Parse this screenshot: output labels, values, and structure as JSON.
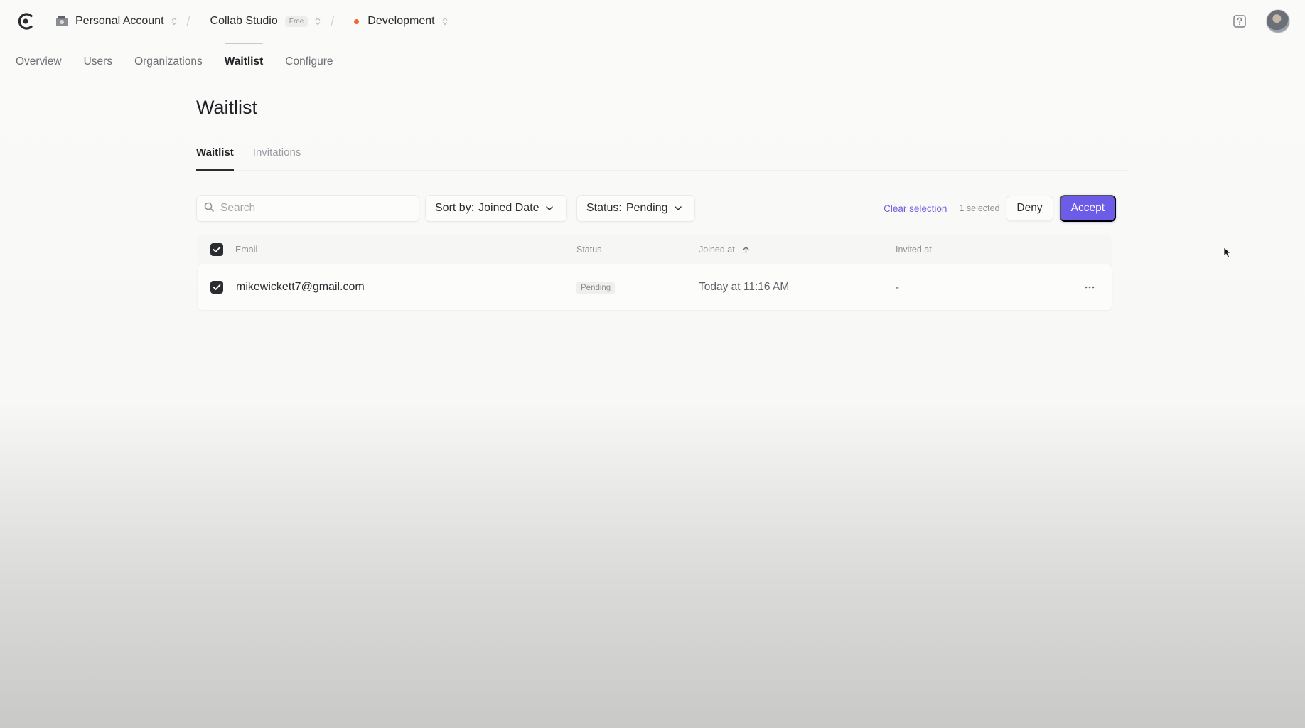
{
  "topbar": {
    "account_label": "Personal Account",
    "app_name": "Collab Studio",
    "plan_badge": "Free",
    "environment": "Development",
    "env_dot_color": "#f0673a"
  },
  "nav": {
    "items": [
      {
        "label": "Overview"
      },
      {
        "label": "Users"
      },
      {
        "label": "Organizations"
      },
      {
        "label": "Waitlist",
        "active": true
      },
      {
        "label": "Configure"
      }
    ]
  },
  "page": {
    "title": "Waitlist",
    "tabs": [
      {
        "label": "Waitlist",
        "active": true
      },
      {
        "label": "Invitations"
      }
    ]
  },
  "toolbar": {
    "search_placeholder": "Search",
    "sort_label": "Sort by:",
    "sort_value": "Joined Date",
    "status_label": "Status:",
    "status_value": "Pending",
    "clear_selection": "Clear selection",
    "selected_count": "1 selected",
    "deny_label": "Deny",
    "accept_label": "Accept",
    "accent_color": "#6c5ce7"
  },
  "table": {
    "columns": {
      "email": "Email",
      "status": "Status",
      "joined": "Joined at",
      "invited": "Invited at"
    },
    "rows": [
      {
        "email": "mikewickett7@gmail.com",
        "status": "Pending",
        "joined": "Today at 11:16 AM",
        "invited": "-"
      }
    ]
  },
  "icons": {
    "logo": "app-logo-icon",
    "account": "account-icon",
    "help": "help-icon",
    "search": "search-icon",
    "chevron": "chevron-down-icon",
    "more": "more-horizontal-icon"
  }
}
